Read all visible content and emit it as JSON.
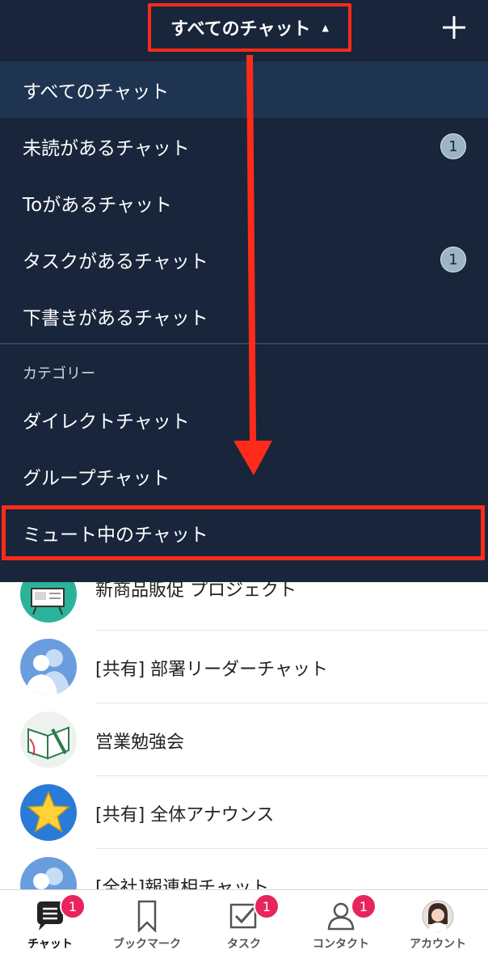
{
  "header": {
    "title": "すべてのチャット",
    "caret": "▲",
    "add_icon": "plus-icon"
  },
  "filter_menu": {
    "items": [
      {
        "label": "すべてのチャット",
        "selected": true
      },
      {
        "label": "未読があるチャット",
        "count": "1"
      },
      {
        "label": "Toがあるチャット"
      },
      {
        "label": "タスクがあるチャット",
        "count": "1"
      },
      {
        "label": "下書きがあるチャット"
      }
    ],
    "category_heading": "カテゴリー",
    "category_items": [
      {
        "label": "ダイレクトチャット"
      },
      {
        "label": "グループチャット"
      },
      {
        "label": "ミュート中のチャット",
        "highlighted": true
      }
    ]
  },
  "chats": [
    {
      "name": "新商品販促 プロジェクト",
      "avatar": "monitor-avatar"
    },
    {
      "name": "[共有] 部署リーダーチャット",
      "avatar": "group-silhouette-avatar"
    },
    {
      "name": "営業勉強会",
      "avatar": "notebook-avatar"
    },
    {
      "name": "[共有] 全体アナウンス",
      "avatar": "star-avatar"
    },
    {
      "name": "[全社]報連相チャット",
      "avatar": "group-silhouette-avatar"
    }
  ],
  "bottom_nav": [
    {
      "label": "チャット",
      "icon": "chat-icon",
      "badge": "1",
      "active": true
    },
    {
      "label": "ブックマーク",
      "icon": "bookmark-icon"
    },
    {
      "label": "タスク",
      "icon": "task-check-icon",
      "badge": "1"
    },
    {
      "label": "コンタクト",
      "icon": "contact-icon",
      "badge": "1"
    },
    {
      "label": "アカウント",
      "icon": "account-avatar-icon"
    }
  ],
  "colors": {
    "header_bg": "#18253a",
    "highlight": "#ff2b1a",
    "badge": "#e8245e",
    "count_badge": "#9db3c6"
  }
}
